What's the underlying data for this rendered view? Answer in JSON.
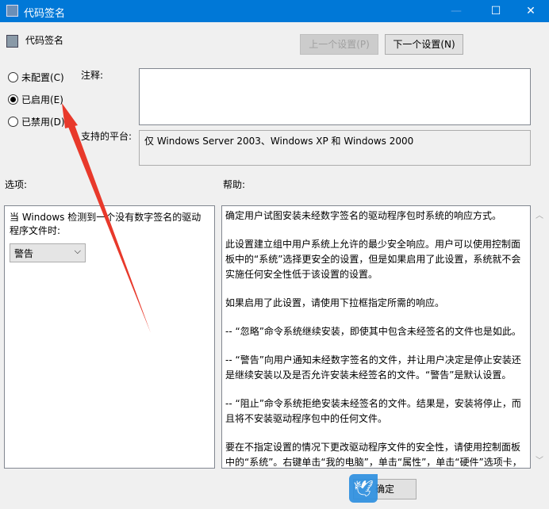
{
  "window": {
    "title": "代码签名",
    "minimize": "—",
    "maximize": "☐",
    "close": "✕"
  },
  "header": {
    "title": "代码签名",
    "prev_button": "上一个设置(P)",
    "next_button": "下一个设置(N)"
  },
  "state": {
    "options": [
      {
        "label": "未配置(C)",
        "checked": false
      },
      {
        "label": "已启用(E)",
        "checked": true
      },
      {
        "label": "已禁用(D)",
        "checked": false
      }
    ]
  },
  "comment": {
    "label": "注释:",
    "value": ""
  },
  "platform": {
    "label": "支持的平台:",
    "value": "仅 Windows Server 2003、Windows XP 和 Windows 2000"
  },
  "options_pane": {
    "label": "选项:",
    "prompt": "当 Windows 检测到一个没有数字签名的驱动程序文件时:",
    "dropdown_value": "警告"
  },
  "help_pane": {
    "label": "帮助:",
    "paragraphs": [
      "确定用户试图安装未经数字签名的驱动程序包时系统的响应方式。",
      "此设置建立组中用户系统上允许的最少安全响应。用户可以使用控制面板中的“系统”选择更安全的设置，但是如果启用了此设置，系统就不会实施任何安全性低于该设置的设置。",
      "如果启用了此设置，请使用下拉框指定所需的响应。",
      "-- “忽略”命令系统继续安装，即使其中包含未经签名的文件也是如此。",
      "-- “警告”向用户通知未经数字签名的文件，并让用户决定是停止安装还是继续安装以及是否允许安装未经签名的文件。“警告”是默认设置。",
      "-- “阻止”命令系统拒绝安装未经签名的文件。结果是，安装将停止，而且将不安装驱动程序包中的任何文件。",
      "要在不指定设置的情况下更改驱动程序文件的安全性，请使用控制面板中的“系统”。右键单击“我的电脑”，单击“属性”，单击“硬件”选项卡，然后单击“驱动程序签名”按钮。"
    ]
  },
  "footer": {
    "ok_button": "确定"
  },
  "colors": {
    "titlebar": "#0078d7",
    "annotation_arrow": "#e8392b"
  }
}
